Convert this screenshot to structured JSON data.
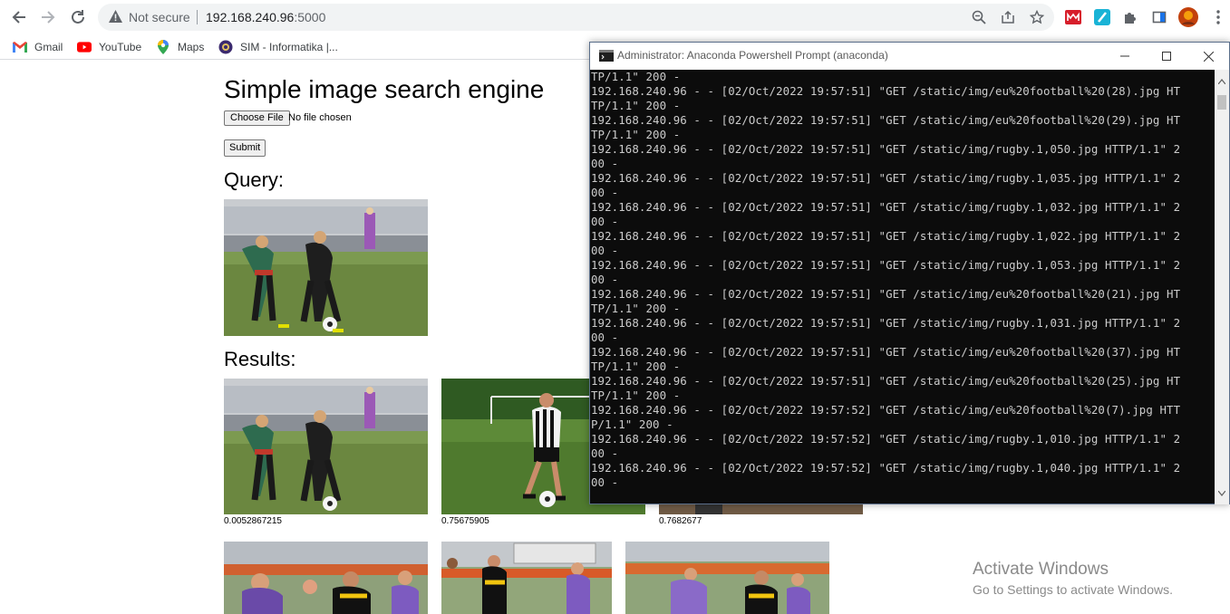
{
  "browser": {
    "security_label": "Not secure",
    "url_host": "192.168.240.96",
    "url_port": ":5000",
    "bookmarks": [
      "Gmail",
      "YouTube",
      "Maps",
      "SIM - Informatika |..."
    ]
  },
  "page": {
    "title": "Simple image search engine",
    "choose_file_label": "Choose File",
    "file_status": "No file chosen",
    "submit_label": "Submit",
    "query_heading": "Query:",
    "results_heading": "Results:",
    "scores": [
      "0.0052867215",
      "0.75675905",
      "0.7682677"
    ]
  },
  "terminal": {
    "title": "Administrator: Anaconda Powershell Prompt (anaconda)",
    "lines": [
      "TP/1.1\" 200 -",
      "192.168.240.96 - - [02/Oct/2022 19:57:51] \"GET /static/img/eu%20football%20(28).jpg HT",
      "TP/1.1\" 200 -",
      "192.168.240.96 - - [02/Oct/2022 19:57:51] \"GET /static/img/eu%20football%20(29).jpg HT",
      "TP/1.1\" 200 -",
      "192.168.240.96 - - [02/Oct/2022 19:57:51] \"GET /static/img/rugby.1,050.jpg HTTP/1.1\" 2",
      "00 -",
      "192.168.240.96 - - [02/Oct/2022 19:57:51] \"GET /static/img/rugby.1,035.jpg HTTP/1.1\" 2",
      "00 -",
      "192.168.240.96 - - [02/Oct/2022 19:57:51] \"GET /static/img/rugby.1,032.jpg HTTP/1.1\" 2",
      "00 -",
      "192.168.240.96 - - [02/Oct/2022 19:57:51] \"GET /static/img/rugby.1,022.jpg HTTP/1.1\" 2",
      "00 -",
      "192.168.240.96 - - [02/Oct/2022 19:57:51] \"GET /static/img/rugby.1,053.jpg HTTP/1.1\" 2",
      "00 -",
      "192.168.240.96 - - [02/Oct/2022 19:57:51] \"GET /static/img/eu%20football%20(21).jpg HT",
      "TP/1.1\" 200 -",
      "192.168.240.96 - - [02/Oct/2022 19:57:51] \"GET /static/img/rugby.1,031.jpg HTTP/1.1\" 2",
      "00 -",
      "192.168.240.96 - - [02/Oct/2022 19:57:51] \"GET /static/img/eu%20football%20(37).jpg HT",
      "TP/1.1\" 200 -",
      "192.168.240.96 - - [02/Oct/2022 19:57:51] \"GET /static/img/eu%20football%20(25).jpg HT",
      "TP/1.1\" 200 -",
      "192.168.240.96 - - [02/Oct/2022 19:57:52] \"GET /static/img/eu%20football%20(7).jpg HTT",
      "P/1.1\" 200 -",
      "192.168.240.96 - - [02/Oct/2022 19:57:52] \"GET /static/img/rugby.1,010.jpg HTTP/1.1\" 2",
      "00 -",
      "192.168.240.96 - - [02/Oct/2022 19:57:52] \"GET /static/img/rugby.1,040.jpg HTTP/1.1\" 2",
      "00 -"
    ]
  },
  "watermark": {
    "title": "Activate Windows",
    "subtitle": "Go to Settings to activate Windows."
  },
  "colors": {
    "terminal_bg": "#0c0c0c",
    "terminal_text": "#cccccc",
    "grass": "#6f8a3c",
    "omnibox_bg": "#f1f3f4"
  }
}
